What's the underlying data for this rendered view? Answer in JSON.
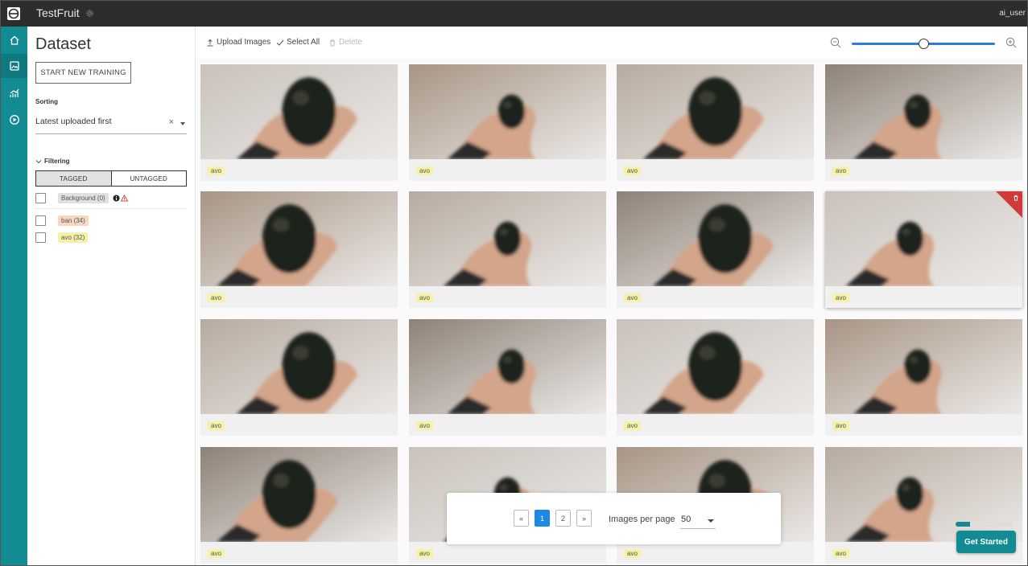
{
  "app": {
    "title": "TestFruit",
    "user": "ai_user"
  },
  "nav": [
    {
      "icon": "home-icon"
    },
    {
      "icon": "dataset-icon"
    },
    {
      "icon": "analytics-icon"
    },
    {
      "icon": "deploy-icon"
    }
  ],
  "panel": {
    "title": "Dataset",
    "train_button": "START NEW TRAINING",
    "sorting_label": "Sorting",
    "sorting_value": "Latest uploaded first",
    "clear_symbol": "×",
    "filtering_label": "Filtering",
    "tabs": [
      "TAGGED",
      "UNTAGGED"
    ],
    "filters": [
      {
        "label": "Background (0)",
        "kind": "bg"
      },
      {
        "label": "ban (34)",
        "kind": "ban"
      },
      {
        "label": "avo (32)",
        "kind": "avo"
      }
    ]
  },
  "toolbar": {
    "upload": "Upload Images",
    "select_all": "Select All",
    "delete": "Delete",
    "zoom_level": 0.5
  },
  "images": [
    {
      "tag": "avo"
    },
    {
      "tag": "avo"
    },
    {
      "tag": "avo"
    },
    {
      "tag": "avo"
    },
    {
      "tag": "avo"
    },
    {
      "tag": "avo"
    },
    {
      "tag": "avo"
    },
    {
      "tag": "avo"
    },
    {
      "tag": "avo"
    },
    {
      "tag": "avo"
    },
    {
      "tag": "avo"
    },
    {
      "tag": "avo"
    },
    {
      "tag": "avo"
    },
    {
      "tag": "avo"
    },
    {
      "tag": "avo"
    },
    {
      "tag": "avo"
    }
  ],
  "pagination": {
    "prev": "«",
    "pages": [
      "1",
      "2"
    ],
    "current": "1",
    "next": "»",
    "per_page_label": "Images per page",
    "per_page_value": "50"
  },
  "onboarding": {
    "button": "Get Started",
    "progress": 0.25
  },
  "colors": {
    "accent": "#138b93",
    "topbar": "#2d2d2d",
    "primary": "#1e88e5",
    "danger": "#d03a3a"
  }
}
